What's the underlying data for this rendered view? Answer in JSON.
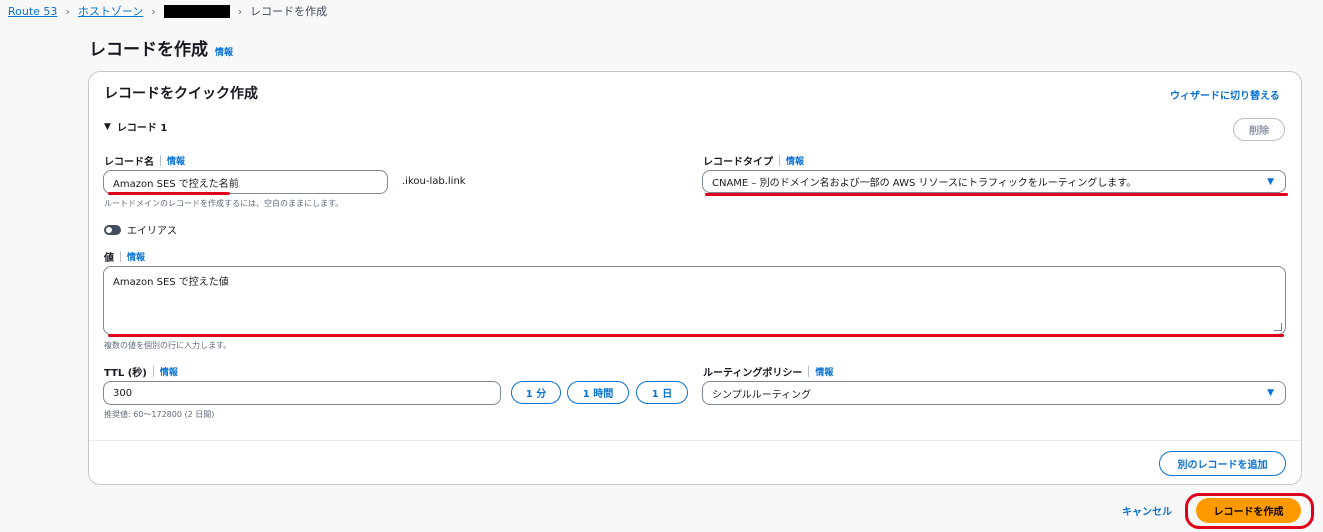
{
  "breadcrumb": {
    "items": [
      "Route 53",
      "ホストゾーン"
    ],
    "current": "レコードを作成"
  },
  "page": {
    "title": "レコードを作成",
    "info": "情報"
  },
  "card": {
    "title": "レコードをクイック作成",
    "wizard_link": "ウィザードに切り替える",
    "record_label": "レコード 1",
    "delete_label": "削除"
  },
  "fields": {
    "record_name": {
      "label": "レコード名",
      "info": "情報",
      "value": "Amazon SES で控えた名前",
      "suffix": ".ikou-lab.link",
      "hint": "ルートドメインのレコードを作成するには、空白のままにします。"
    },
    "record_type": {
      "label": "レコードタイプ",
      "info": "情報",
      "value": "CNAME – 別のドメイン名および一部の AWS リソースにトラフィックをルーティングします。"
    },
    "alias": {
      "label": "エイリアス"
    },
    "value": {
      "label": "値",
      "info": "情報",
      "value": "Amazon SES で控えた値",
      "hint": "複数の値を個別の行に入力します。"
    },
    "ttl": {
      "label": "TTL (秒)",
      "info": "情報",
      "value": "300",
      "hint": "推奨値: 60～172800 (2 日間)",
      "buttons": [
        "1 分",
        "1 時間",
        "1 日"
      ]
    },
    "routing_policy": {
      "label": "ルーティングポリシー",
      "info": "情報",
      "value": "シンプルルーティング"
    }
  },
  "actions": {
    "add_record": "別のレコードを追加",
    "cancel": "キャンセル",
    "create": "レコードを作成"
  },
  "colors": {
    "link": "#0972d3",
    "primary": "#ff9900",
    "annotation": "#e0001a"
  }
}
